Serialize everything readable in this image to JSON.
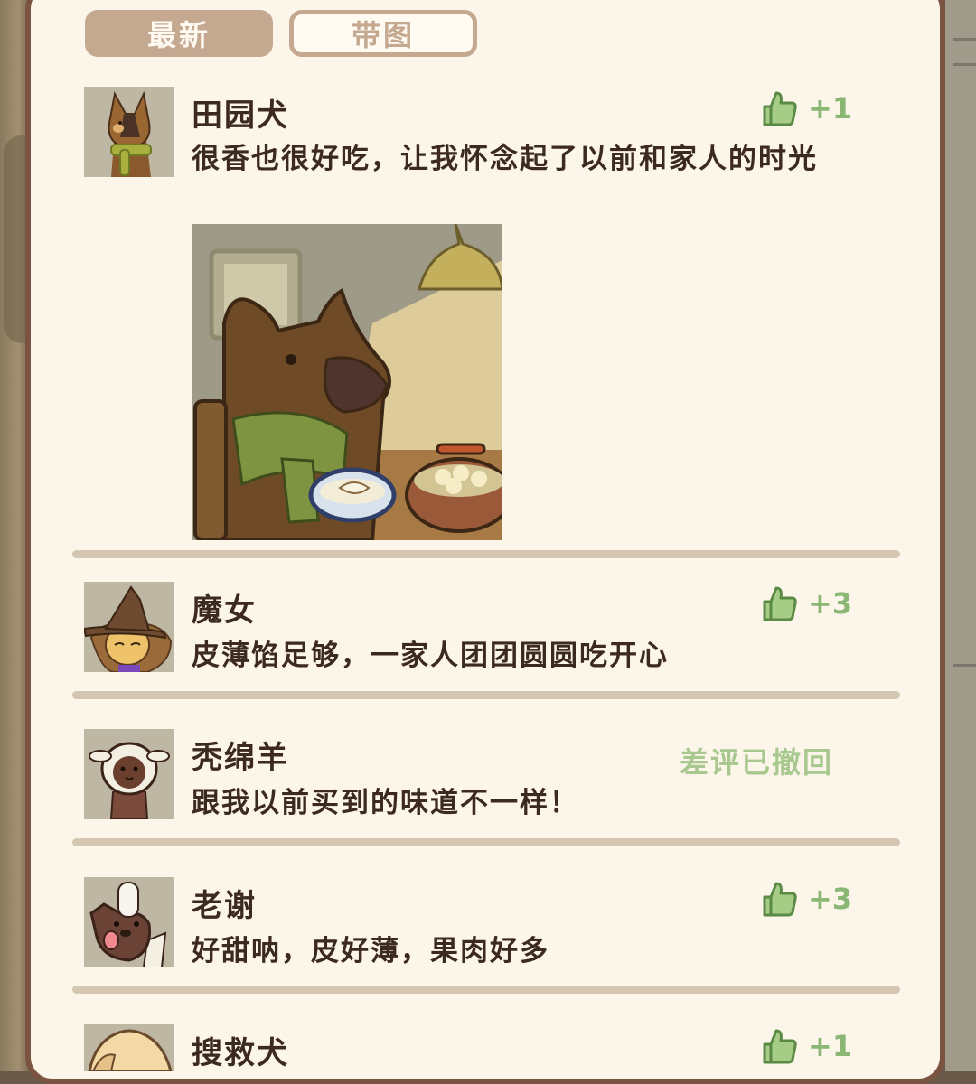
{
  "tabs": {
    "latest": "最新",
    "with_image": "带图"
  },
  "reviews": [
    {
      "name": "田园犬",
      "text": "很香也很好吃，让我怀念起了以前和家人的时光",
      "likes": "+1",
      "avatar": "farm-dog-scarf"
    },
    {
      "name": "魔女",
      "text": "皮薄馅足够，一家人团团圆圆吃开心",
      "likes": "+3",
      "avatar": "witch-hat"
    },
    {
      "name": "秃绵羊",
      "text": "跟我以前买到的味道不一样！",
      "status": "差评已撤回",
      "avatar": "bald-sheep"
    },
    {
      "name": "老谢",
      "text": "好甜呐，皮好薄，果肉好多",
      "likes": "+3",
      "avatar": "chef-dog"
    },
    {
      "name": "搜救犬",
      "text": "",
      "likes": "+1",
      "avatar": "rescue-dog"
    }
  ],
  "colors": {
    "panel_bg": "#fcf5ea",
    "border": "#7a5440",
    "tab_active": "#c4a890",
    "like_green": "#8ab774",
    "text_dark": "#3d2a1e",
    "divider": "#d3c7b2"
  },
  "icons": {
    "like": "thumbs-up-icon"
  }
}
